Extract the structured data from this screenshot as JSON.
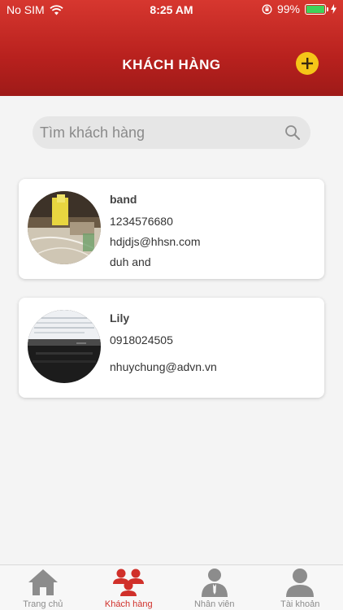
{
  "status_bar": {
    "carrier": "No SIM",
    "time": "8:25 AM",
    "battery_percent": "99%",
    "battery_level": 0.99
  },
  "header": {
    "title": "KHÁCH HÀNG",
    "add_icon": "plus-circle-icon",
    "accent_color": "#f5c518",
    "background_color": "#b8211e"
  },
  "search": {
    "placeholder": "Tìm khách hàng",
    "icon": "search-icon"
  },
  "customers": [
    {
      "name": "band",
      "phone": "1234576680",
      "email": "hdjdjs@hhsn.com",
      "address": "duh and"
    },
    {
      "name": "Lily",
      "phone": "0918024505",
      "email": "nhuychung@advn.vn",
      "address": ""
    }
  ],
  "tabbar": {
    "active_color": "#d0302a",
    "tabs": [
      {
        "label": "Trang chủ",
        "icon": "home-icon"
      },
      {
        "label": "Khách hàng",
        "icon": "customers-icon"
      },
      {
        "label": "Nhân viên",
        "icon": "employee-icon"
      },
      {
        "label": "Tài khoản",
        "icon": "account-icon"
      }
    ]
  }
}
